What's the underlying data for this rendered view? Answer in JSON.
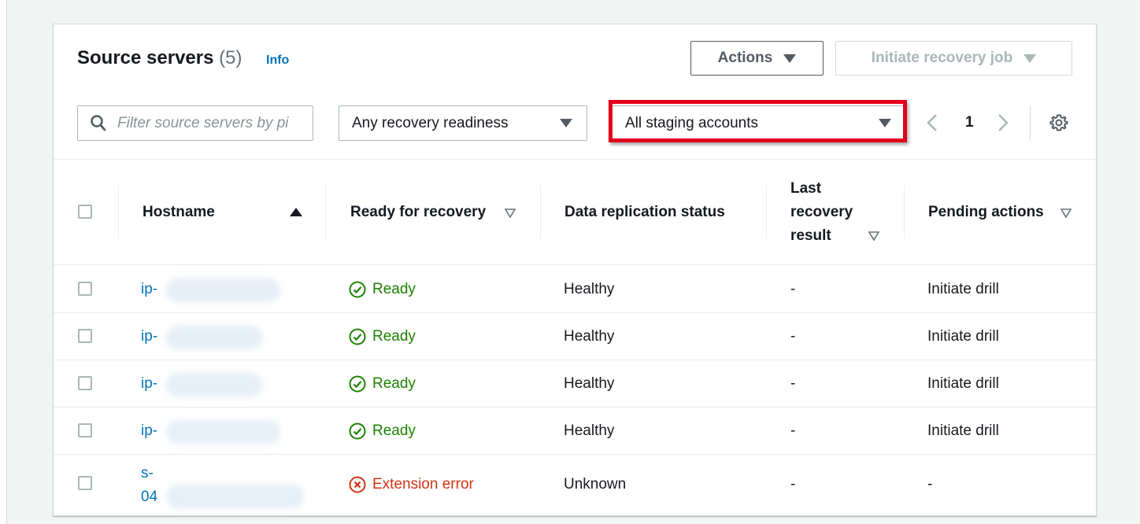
{
  "header": {
    "title": "Source servers",
    "count": "(5)",
    "info_label": "Info",
    "actions_label": "Actions",
    "initiate_label": "Initiate recovery job"
  },
  "filters": {
    "search_placeholder": "Filter source servers by pi",
    "readiness_value": "Any recovery readiness",
    "staging_value": "All staging accounts"
  },
  "pagination": {
    "current_page": "1"
  },
  "table": {
    "columns": {
      "hostname": "Hostname",
      "ready": "Ready for recovery",
      "replication": "Data replication status",
      "last_result_1": "Last",
      "last_result_2": "recovery",
      "last_result_3": "result",
      "pending": "Pending actions"
    },
    "rows": [
      {
        "host": "ip-",
        "host2": "",
        "ready": "Ready",
        "replication": "Healthy",
        "last": "-",
        "pending": "Initiate drill"
      },
      {
        "host": "ip-",
        "host2": "",
        "ready": "Ready",
        "replication": "Healthy",
        "last": "-",
        "pending": "Initiate drill"
      },
      {
        "host": "ip-",
        "host2": "",
        "ready": "Ready",
        "replication": "Healthy",
        "last": "-",
        "pending": "Initiate drill"
      },
      {
        "host": "ip-",
        "host2": "",
        "ready": "Ready",
        "replication": "Healthy",
        "last": "-",
        "pending": "Initiate drill"
      },
      {
        "host": "s-",
        "host2": "04",
        "ready": "Extension error",
        "replication": "Unknown",
        "last": "-",
        "pending": "-"
      }
    ]
  },
  "colors": {
    "link": "#0073bb",
    "success": "#1d8102",
    "error": "#d13212",
    "highlight": "#e3001b"
  },
  "icons": {
    "search": "search-icon",
    "settings": "gear-icon",
    "ok": "check-circle-icon",
    "error": "x-circle-icon"
  }
}
